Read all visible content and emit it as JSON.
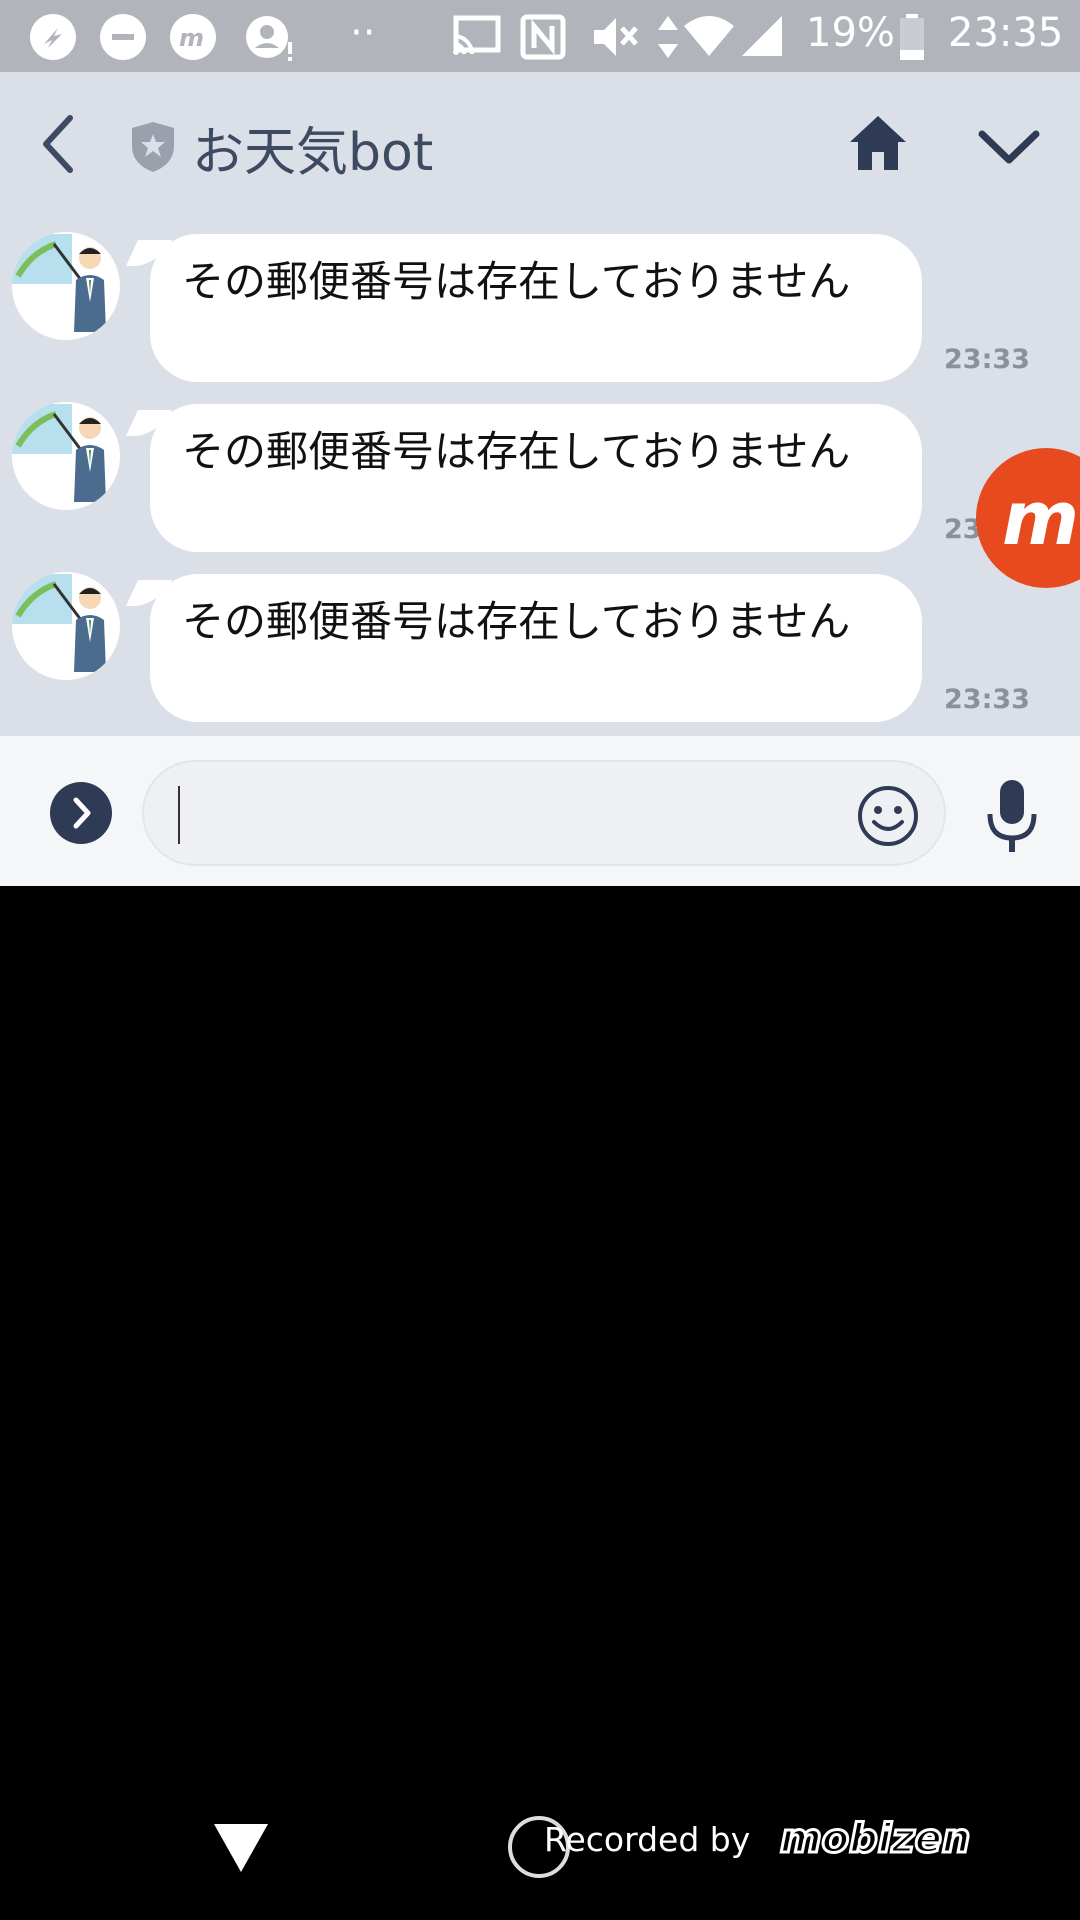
{
  "status_bar": {
    "battery": "19%",
    "time": "23:35",
    "dots": "··"
  },
  "header": {
    "title": "お天気bot"
  },
  "messages": [
    {
      "text": "その郵便番号は存在しておりません",
      "time": "23:33"
    },
    {
      "text": "その郵便番号は存在しておりません",
      "time": "23:33"
    },
    {
      "text": "その郵便番号は存在しておりません",
      "time": "23:33"
    }
  ],
  "input": {
    "value": ""
  },
  "watermark": {
    "recorded_by": "Recorded by",
    "brand": "mobizen"
  },
  "colors": {
    "chat_background": "#dadfe8",
    "header_text": "#3e4a61",
    "mobizen_orange": "#e84a1f",
    "status_bar": "#b1b5bb"
  }
}
